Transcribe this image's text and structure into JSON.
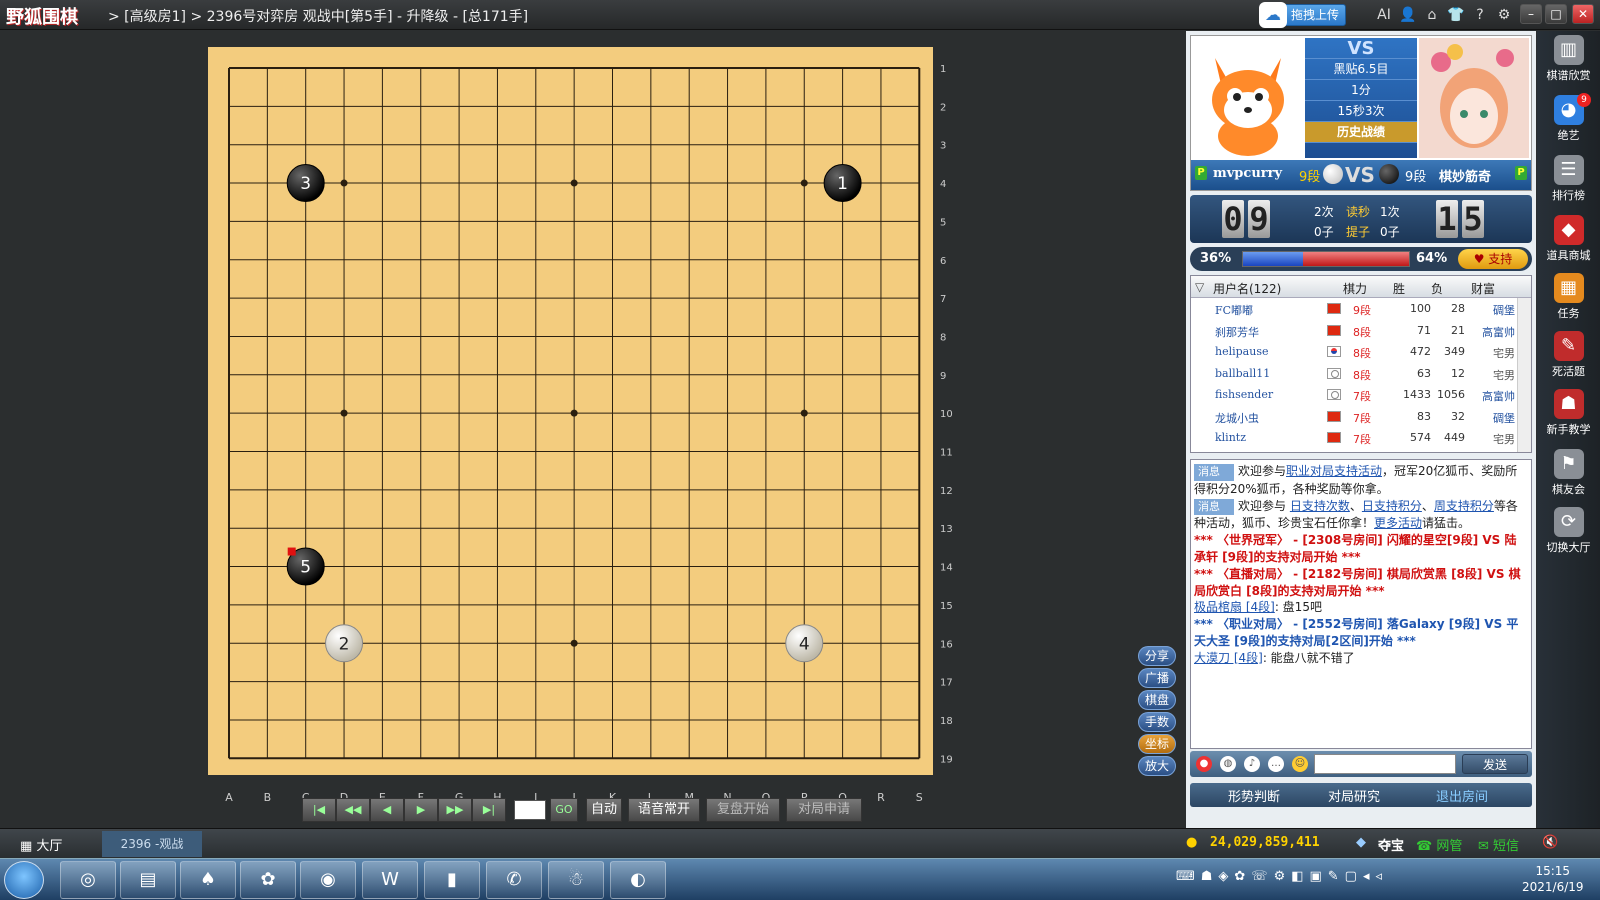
{
  "titlebar": {
    "logo": "野狐围棋",
    "breadcrumb": "> [高级房1] > 2396号对弈房 观战中[第5手] - 升降级 - [总171手]",
    "upload_label": "拖拽上传",
    "ai_label": "AI"
  },
  "board": {
    "size": 19,
    "col_labels": [
      "A",
      "B",
      "C",
      "D",
      "E",
      "F",
      "G",
      "H",
      "I",
      "J",
      "K",
      "L",
      "M",
      "N",
      "O",
      "P",
      "Q",
      "R",
      "S"
    ],
    "row_labels": [
      "1",
      "2",
      "3",
      "4",
      "5",
      "6",
      "7",
      "8",
      "9",
      "10",
      "11",
      "12",
      "13",
      "14",
      "15",
      "16",
      "17",
      "18",
      "19"
    ],
    "star_points": [
      [
        3,
        3
      ],
      [
        3,
        9
      ],
      [
        3,
        15
      ],
      [
        9,
        3
      ],
      [
        9,
        9
      ],
      [
        9,
        15
      ],
      [
        15,
        3
      ],
      [
        15,
        9
      ],
      [
        15,
        15
      ]
    ],
    "stones": [
      {
        "num": "1",
        "color": "black",
        "col": 16,
        "row": 3
      },
      {
        "num": "2",
        "color": "white",
        "col": 3,
        "row": 15
      },
      {
        "num": "3",
        "color": "black",
        "col": 2,
        "row": 3
      },
      {
        "num": "4",
        "color": "white",
        "col": 15,
        "row": 15
      },
      {
        "num": "5",
        "color": "black",
        "col": 2,
        "row": 13,
        "last": true
      }
    ],
    "colors": {
      "wood": "#f3cc7e",
      "line": "#2a1f10",
      "last_marker": "#e01010"
    }
  },
  "float_buttons": [
    "分享",
    "广播",
    "棋盘",
    "手数",
    "坐标",
    "放大"
  ],
  "nav": {
    "auto": "自动",
    "voice": "语音常开",
    "replay": "复盘开始",
    "request": "对局申请",
    "go": "GO"
  },
  "match": {
    "vs": "VS",
    "komi": "黑贴6.5目",
    "time": "1分",
    "byoyomi": "15秒3次",
    "history": "历史战绩",
    "white_player": "mvpcurry",
    "white_rank": "9段",
    "black_player": "棋妙筋奇",
    "black_rank": "9段",
    "p_badge": "P"
  },
  "clock": {
    "left_digits": [
      "0",
      "9"
    ],
    "right_digits": [
      "1",
      "5"
    ],
    "left_byoyomi": "2次",
    "byoyomi_label": "读秒",
    "right_byoyomi": "1次",
    "left_captures": "0子",
    "captures_label": "提子",
    "right_captures": "0子"
  },
  "support": {
    "left_pct": "36%",
    "right_pct": "64%",
    "left_fraction": 0.36,
    "btn": "♥ 支持"
  },
  "users": {
    "headers": {
      "name": "用户名(122)",
      "rank": "棋力",
      "win": "胜",
      "loss": "负",
      "wealth": "财富"
    },
    "rows": [
      {
        "name": "FC嘟嘟",
        "flag": "cn",
        "rank": "9段",
        "win": "100",
        "loss": "28",
        "wealth": "碉堡"
      },
      {
        "name": "刹那芳华",
        "flag": "cn",
        "rank": "8段",
        "win": "71",
        "loss": "21",
        "wealth": "高富帅"
      },
      {
        "name": "helipause",
        "flag": "kr",
        "rank": "8段",
        "win": "472",
        "loss": "349",
        "wealth": "宅男"
      },
      {
        "name": "ballball11",
        "flag": "other",
        "rank": "8段",
        "win": "63",
        "loss": "12",
        "wealth": "宅男"
      },
      {
        "name": "fishsender",
        "flag": "other",
        "rank": "7段",
        "win": "1433",
        "loss": "1056",
        "wealth": "高富帅"
      },
      {
        "name": "龙城小虫",
        "flag": "cn",
        "rank": "7段",
        "win": "83",
        "loss": "32",
        "wealth": "碉堡"
      },
      {
        "name": "klintz",
        "flag": "cn",
        "rank": "7段",
        "win": "574",
        "loss": "449",
        "wealth": "宅男"
      }
    ]
  },
  "chat": {
    "msg_tag": "消息",
    "l1a": "欢迎参与",
    "l1link": "职业对局支持活动",
    "l1b": "，冠军20亿狐币、奖励所得积分20%狐币，各种奖励等你拿。",
    "l2a": "欢迎参与",
    "l2link1": "日支持次数",
    "l2link2": "日支持积分",
    "l2link3": "周支持积分",
    "l2b": "等各种活动，狐币、珍贵宝石任你拿！",
    "l2link4": "更多活动",
    "l2c": "请猛击。",
    "l3": "*** 〈世界冠军〉 - [2308号房间] 闪耀的星空[9段] VS 陆承轩 [9段]的支持对局开始 ***",
    "l4": "*** 〈直播对局〉 - [2182号房间] 棋局欣赏黑 [8段] VS 棋局欣赏白 [8段]的支持对局开始 ***",
    "l5user": "极品棺扇 [4段]",
    "l5msg": ": 盘15吧",
    "l6": "*** 〈职业对局〉 - [2552号房间] 落Galaxy [9段] VS 平天大圣 [9段]的支持对局[2区间]开始 ***",
    "l7user": "大漠刀 [4段]",
    "l7msg": ": 能盘八就不错了",
    "send": "发送"
  },
  "bottom_tabs": [
    "形势判断",
    "对局研究",
    "退出房间"
  ],
  "sidebar": [
    {
      "label": "棋谱欣赏",
      "icon": "book-icon",
      "color": "#8a8f96"
    },
    {
      "label": "绝艺",
      "icon": "ai-icon",
      "color": "#2f7fe0"
    },
    {
      "label": "排行榜",
      "icon": "list-icon",
      "color": "#8a8f96"
    },
    {
      "label": "道具商城",
      "icon": "gem-icon",
      "color": "#d02a2a"
    },
    {
      "label": "任务",
      "icon": "task-icon",
      "color": "#e58a1e"
    },
    {
      "label": "死活题",
      "icon": "pen-icon",
      "color": "#c02c2c"
    },
    {
      "label": "新手教学",
      "icon": "teacher-icon",
      "color": "#c02c2c"
    },
    {
      "label": "棋友会",
      "icon": "flag-icon",
      "color": "#8a8f96"
    },
    {
      "label": "切换大厅",
      "icon": "switch-icon",
      "color": "#8a8f96"
    }
  ],
  "sidebar_badge": "9",
  "status": {
    "lobby": "大厅",
    "room_tab": "2396 -观战",
    "coins": "24,029,859,411",
    "treasure": "夺宝",
    "netadmin": "网管",
    "sms": "短信"
  },
  "taskbar": {
    "time": "15:15",
    "date": "2021/6/19"
  }
}
